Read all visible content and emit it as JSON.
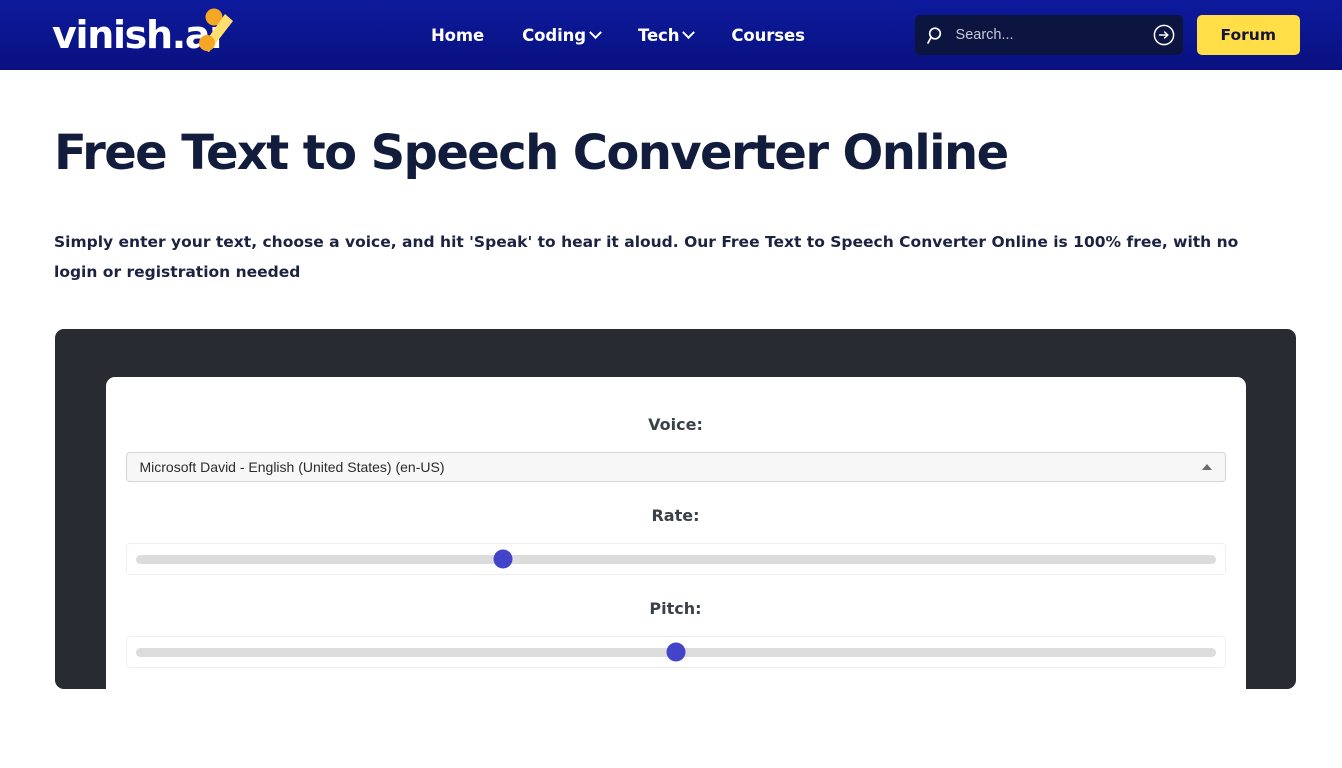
{
  "header": {
    "brand": {
      "name": "vinish.ai",
      "text_main": "vinish.",
      "text_accent": "ai"
    },
    "nav": [
      {
        "label": "Home",
        "has_dropdown": false
      },
      {
        "label": "Coding",
        "has_dropdown": true
      },
      {
        "label": "Tech",
        "has_dropdown": true
      },
      {
        "label": "Courses",
        "has_dropdown": false
      }
    ],
    "search": {
      "placeholder": "Search...",
      "value": "",
      "icon": "search-icon",
      "submit_icon": "arrow-right-circle-icon"
    },
    "forum_label": "Forum",
    "colors": {
      "header_bg": "#0b1694",
      "search_bg": "#0c1440",
      "forum_bg": "#ffde48",
      "forum_text": "#14143c"
    }
  },
  "page": {
    "title": "Free Text to Speech Converter Online",
    "subtitle": "Simply enter your text, choose a voice, and hit 'Speak' to hear it aloud. Our Free Text to Speech Converter Online is 100% free, with no login or registration needed",
    "title_color": "#121c3d"
  },
  "tool": {
    "panel_bg": "#282c32",
    "accent": "#4344ca",
    "voice": {
      "label": "Voice:",
      "selected": "Microsoft David - English (United States) (en-US)",
      "caret_icon": "caret-up-icon"
    },
    "rate": {
      "label": "Rate:",
      "percent": 34
    },
    "pitch": {
      "label": "Pitch:",
      "percent": 50
    }
  }
}
